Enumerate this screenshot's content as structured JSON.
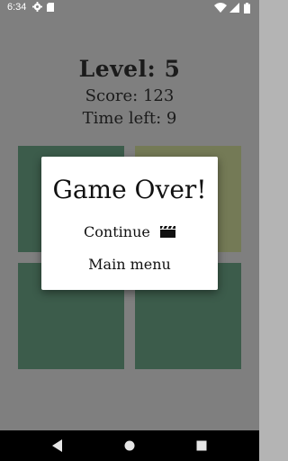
{
  "status_bar": {
    "time": "6:34",
    "icons": [
      "gear-icon",
      "sd-card-icon",
      "wifi-icon",
      "signal-icon",
      "battery-icon"
    ]
  },
  "hud": {
    "level": "Level: 5",
    "score": "Score: 123",
    "time_left": "Time left: 9"
  },
  "tiles": {
    "colors": [
      "#3c5c4b",
      "#747a56",
      "#3c5c4b",
      "#3c5c4b"
    ]
  },
  "dialog": {
    "title": "Game Over!",
    "continue_label": "Continue",
    "continue_icon": "clapperboard-icon",
    "main_menu_label": "Main menu"
  },
  "nav_bar": {
    "buttons": [
      "back-icon",
      "home-icon",
      "recents-icon"
    ]
  }
}
